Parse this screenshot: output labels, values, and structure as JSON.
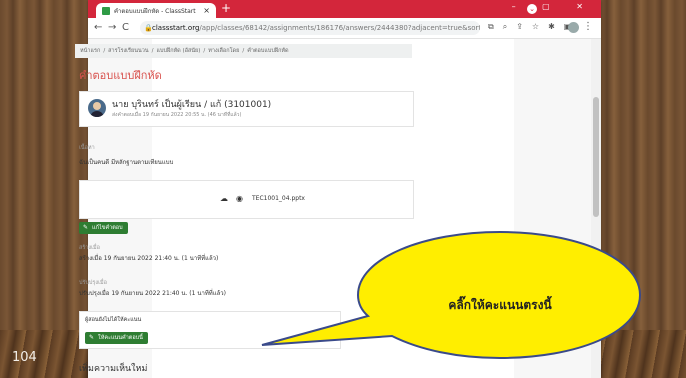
{
  "slide": {
    "number": "104"
  },
  "browser": {
    "tab_title": "คำตอบแบบฝึกหัด - ClassStart",
    "tab_close": "×",
    "new_tab": "+",
    "window_controls": "–  ▢  ✕",
    "url_host": "classstart.org",
    "url_path": "/app/classes/68142/assignments/186176/answers/2444380?adjacent=true&sorted_..."
  },
  "page": {
    "breadcrumbs": [
      "หน้าแรก",
      "/",
      "สารโรงเรียนนวน",
      "/",
      "แบบฝึกหัด (อัสนัย)",
      "/",
      "ทางเลือกโดย",
      "/",
      "คำตอบแบบฝึกหัด"
    ],
    "title": "คำตอบแบบฝึกหัด",
    "student_name": "นาย บุรินทร์ เป็นผู้เรียน / แก้ (3101001)",
    "submitted_at": "ส่งคำตอบเมื่อ 19 กันยายน 2022 20:55 น. (46 นาทีที่แล้ว)",
    "content_label": "เนื้อหา",
    "content_text": "ฉันเป็นคนดี มีหลักฐานตามเทียนแบบ",
    "file_name": "TEC1001_04.pptx",
    "edit_answer_button": "แก้ไขคำตอบ",
    "created_label": "สร้างเมื่อ",
    "created_text": "สร้างเมื่อ 19 กันยายน 2022 21:40 น. (1 นาทีที่แล้ว)",
    "updated_label": "ปรับปรุงเมื่อ",
    "updated_text": "ปรับปรุงเมื่อ 19 กันยายน 2022 21:40 น. (1 นาทีที่แล้ว)",
    "grade_note": "ผู้สอนยังไม่ได้ให้คะแนน",
    "grade_button": "ให้คะแนนคำตอบนี้",
    "comment_heading": "เพิ่มความเห็นใหม่"
  },
  "callout": {
    "text": "คลิ๊กให้คะแนนตรงนี้",
    "color": "#ffee00"
  },
  "colors": {
    "tabbar": "#d3263b",
    "title": "#d9534f",
    "button": "#2e7d32"
  }
}
